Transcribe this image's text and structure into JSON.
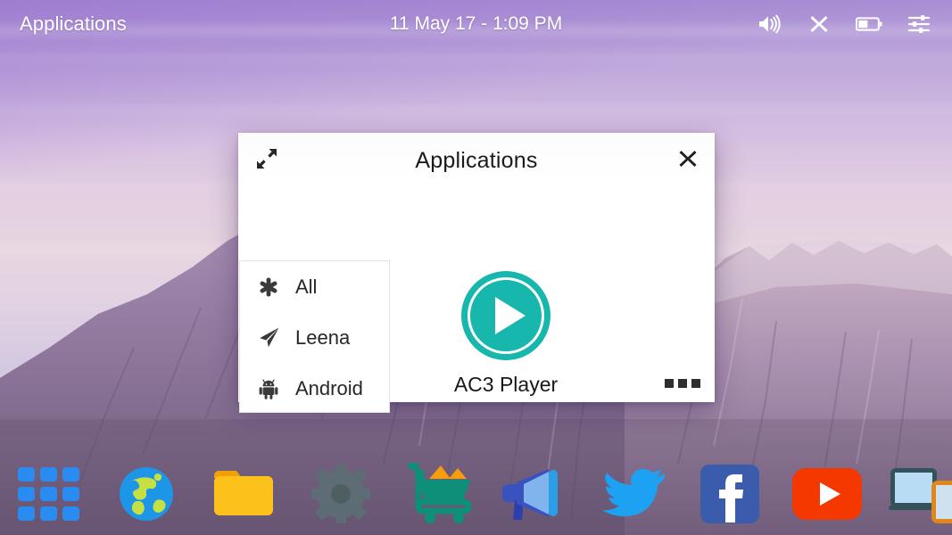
{
  "topbar": {
    "title": "Applications",
    "clock": "11 May 17 - 1:09 PM",
    "icons": [
      {
        "name": "volume-icon",
        "label": "Volume"
      },
      {
        "name": "close-icon",
        "label": "Close"
      },
      {
        "name": "battery-icon",
        "label": "Battery"
      },
      {
        "name": "settings-sliders-icon",
        "label": "Settings"
      }
    ]
  },
  "dialog": {
    "title": "Applications",
    "expand_label": "Expand",
    "close_label": "Close",
    "more_label": "More options",
    "sidebar": [
      {
        "label": "All",
        "icon": "asterisk-icon"
      },
      {
        "label": "Leena",
        "icon": "paper-plane-icon"
      },
      {
        "label": "Android",
        "icon": "android-icon"
      }
    ],
    "apps": [
      {
        "label": "AC3 Player",
        "icon": "play-circle-icon",
        "color": "#18b7ae"
      }
    ]
  },
  "taskbar": {
    "items": [
      {
        "name": "app-grid",
        "label": "All Apps"
      },
      {
        "name": "browser",
        "label": "Browser"
      },
      {
        "name": "files",
        "label": "Files"
      },
      {
        "name": "settings",
        "label": "Settings"
      },
      {
        "name": "store",
        "label": "Store"
      },
      {
        "name": "announcements",
        "label": "Announcements"
      },
      {
        "name": "twitter",
        "label": "Twitter"
      },
      {
        "name": "facebook",
        "label": "Facebook"
      },
      {
        "name": "youtube",
        "label": "YouTube"
      },
      {
        "name": "devices",
        "label": "Devices"
      }
    ]
  },
  "colors": {
    "accent_teal": "#18b7ae",
    "grid_blue": "#2a8cf0",
    "folder_yellow": "#fcc21b",
    "facebook_blue": "#3b5bac",
    "youtube_red": "#f43800",
    "twitter_blue": "#1da1f2",
    "store_green": "#0e8f7a",
    "sky_top": "#a98fd4",
    "sky_bottom": "#c4bcdc"
  }
}
